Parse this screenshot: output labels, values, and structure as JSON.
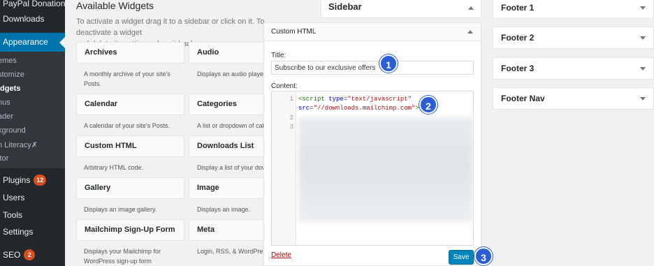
{
  "admin_menu": {
    "top_items": [
      {
        "label": "PayPal Donations"
      },
      {
        "label": "Downloads"
      }
    ],
    "appearance": {
      "label": "Appearance"
    },
    "submenu": [
      {
        "label": "emes"
      },
      {
        "label": "stomize"
      },
      {
        "label": "idgets"
      },
      {
        "label": "nus"
      },
      {
        "label": "ader"
      },
      {
        "label": "kground"
      },
      {
        "label": "h Literacy"
      },
      {
        "label": "itor"
      }
    ],
    "bottom_items": [
      {
        "label": "Plugins",
        "badge": "12"
      },
      {
        "label": "Users"
      },
      {
        "label": "Tools"
      },
      {
        "label": "Settings"
      },
      {
        "label": "SEO",
        "badge": "2"
      }
    ]
  },
  "available_widgets": {
    "title": "Available Widgets",
    "description_line1": "To activate a widget drag it to a sidebar or click on it. To deactivate a widget",
    "description_line2": "and delete its settings, drag it back.",
    "widgets": [
      {
        "name": "Archives",
        "desc": "A monthly archive of your site's",
        "desc2": "Posts."
      },
      {
        "name": "Audio",
        "desc": "Displays an audio player.",
        "desc2": ""
      },
      {
        "name": "Calendar",
        "desc": "A calendar of your site's Posts.",
        "desc2": ""
      },
      {
        "name": "Categories",
        "desc": "A list or dropdown of cat",
        "desc2": ""
      },
      {
        "name": "Custom HTML",
        "desc": "Arbitrary HTML code.",
        "desc2": ""
      },
      {
        "name": "Downloads List",
        "desc": "Display a list of your dow",
        "desc2": ""
      },
      {
        "name": "Gallery",
        "desc": "Displays an image gallery.",
        "desc2": ""
      },
      {
        "name": "Image",
        "desc": "Displays an image.",
        "desc2": ""
      },
      {
        "name": "Mailchimp Sign-Up Form",
        "desc": "Displays your Mailchimp for",
        "desc2": "WordPress sign-up form"
      },
      {
        "name": "Meta",
        "desc": "Login, RSS, & WordPress",
        "desc2": ""
      }
    ]
  },
  "sidebar_area": {
    "title": "Sidebar"
  },
  "custom_html_widget": {
    "title": "Custom HTML",
    "title_label": "Title:",
    "title_value": "Subscribe to our exclusive offers",
    "content_label": "Content:",
    "code_lines": [
      {
        "no": "1",
        "part1": "<script ",
        "attr1": "type",
        "eq1": "=",
        "str1": "\"text/javascript\""
      },
      {
        "no": "",
        "attr2": "src",
        "eq2": "=",
        "str2": "\"//downloads.mailchimp.com\"",
        "end": ">"
      },
      {
        "no": "2"
      },
      {
        "no": "3"
      }
    ],
    "delete_label": "Delete",
    "save_label": "Save"
  },
  "callouts": [
    "1",
    "2",
    "3"
  ],
  "footer_areas": [
    {
      "title": "Footer 1"
    },
    {
      "title": "Footer 2"
    },
    {
      "title": "Footer 3"
    },
    {
      "title": "Footer Nav"
    }
  ],
  "colors": {
    "admin_bg": "#23282d",
    "accent": "#0073aa",
    "save_button": "#0085ba",
    "callout": "#2b5ed6",
    "delete": "#a00"
  }
}
